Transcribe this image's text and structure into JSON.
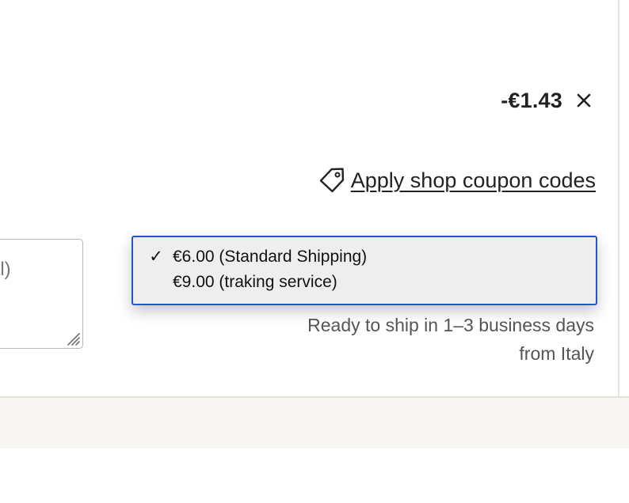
{
  "summary": {
    "discount_amount": "-€1.43"
  },
  "coupon": {
    "link_label": "Apply shop coupon codes"
  },
  "note": {
    "visible_placeholder": "al)"
  },
  "shipping": {
    "options": [
      {
        "check_mark": "✓",
        "label": "€6.00 (Standard Shipping)"
      },
      {
        "check_mark": "",
        "label": "€9.00 (traking service)"
      }
    ],
    "selected_label": "€6.00 (Standard Shipping)",
    "dispatch_line_1": "Ready to ship in 1–3 business days",
    "dispatch_line_2": "from Italy"
  },
  "icons": {
    "remove": "close-icon",
    "coupon": "tag-icon",
    "resize": "resize-grip-icon"
  },
  "colors": {
    "text": "#222222",
    "muted_text": "#555555",
    "dropdown_border": "#2555c7",
    "dropdown_background": "#eeeeee",
    "footer_background": "#f7f6f3"
  }
}
